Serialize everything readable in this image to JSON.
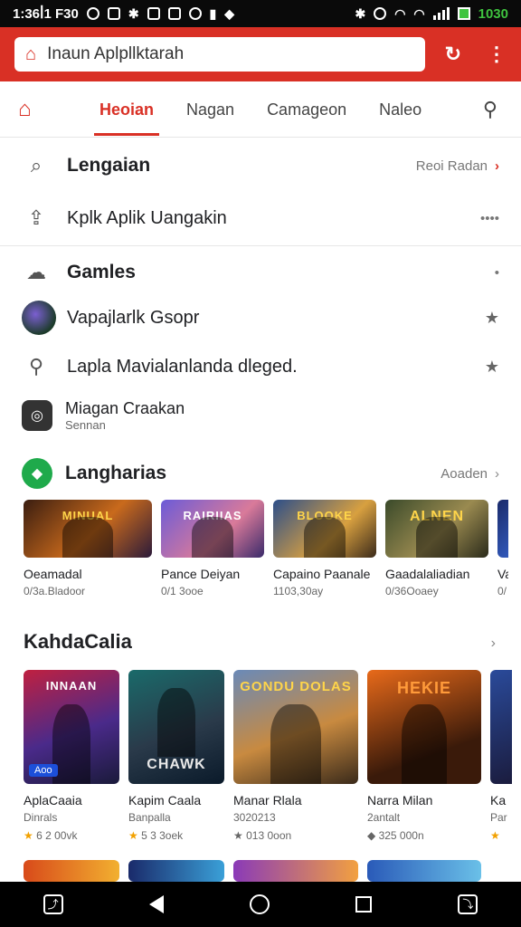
{
  "status_bar": {
    "time": "1:36ꟾ1 F30",
    "time_right": "1030"
  },
  "header": {
    "search_text": "Inaun Aplpllktarah",
    "brand_color": "#d93025"
  },
  "tabs": [
    {
      "label": "Heoian",
      "active": true
    },
    {
      "label": "Nagan",
      "active": false
    },
    {
      "label": "Camageon",
      "active": false
    },
    {
      "label": "Naleo",
      "active": false
    }
  ],
  "menu": {
    "lengaian": {
      "label": "Lengaian",
      "right_text": "Reoi Radan"
    },
    "kplk": {
      "label": "Kplk Aplik Uangakin"
    },
    "games": {
      "label": "Gamles"
    },
    "item1": {
      "label": "Vapajlarlk Gsopr"
    },
    "item2": {
      "label": "Lapla Mavialanlanda dleged."
    },
    "item3": {
      "label": "Miagan Craakan",
      "sub": "Sennan"
    },
    "langharias": {
      "label": "Langharias",
      "right_text": "Aoaden"
    }
  },
  "cards_row1": [
    {
      "title": "Oeamadal",
      "sub": "0/3a.Bladoor",
      "banner": "MINUAL"
    },
    {
      "title": "Pance Deiyan",
      "sub": "0/1 3ooe",
      "banner": "RAIRIIAS"
    },
    {
      "title": "Capaino Paanale",
      "sub": "1103,30ay",
      "banner": "BLOOKE"
    },
    {
      "title": "Gaadalaliadian",
      "sub": "0/36Ooaey",
      "banner": "ALNEN"
    },
    {
      "title": "Va",
      "sub": "0/",
      "banner": ""
    }
  ],
  "section2": {
    "title": "KahdaCalia"
  },
  "cards_row2": [
    {
      "title": "AplaCaaia",
      "sub": "Dinrals",
      "meta": "6 2 00vk",
      "banner": "INNAAN",
      "tag": "Aoo"
    },
    {
      "title": "Kapim Caala",
      "sub": "Banpalla",
      "meta": "5 3 3oek",
      "banner": "CHAWK",
      "tag": ""
    },
    {
      "title": "Manar Rlala",
      "sub": "3020213",
      "meta": "013 0oon",
      "banner": "GONDU DOLAS",
      "tag": ""
    },
    {
      "title": "Narra Milan",
      "sub": "2antalt",
      "meta": "325 000n",
      "banner": "HEKIE",
      "tag": ""
    },
    {
      "title": "Ka",
      "sub": "Par",
      "meta": "5",
      "banner": "",
      "tag": ""
    }
  ],
  "icons": {
    "home": "home-icon",
    "search": "search-icon",
    "refresh": "refresh-icon",
    "more": "more-vert-icon"
  }
}
